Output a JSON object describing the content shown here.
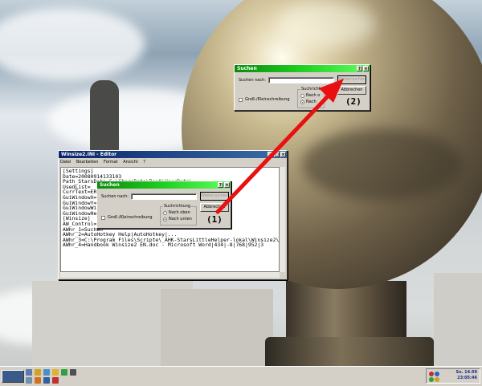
{
  "editor": {
    "title": "Winsize2.INI - Editor",
    "menu": [
      "Datei",
      "Bearbeiten",
      "Format",
      "Ansicht",
      "?"
    ],
    "lines": [
      "[Settings]",
      "Date=20080914133103",
      "Path_StarsData=C:\\StarsData\\Root\\UserData\\",
      "UsedList=",
      "CurrText=ERRO",
      "GuiWindowX=ERR",
      "GuiWindowY=ERR",
      "GuiWindowWidt",
      "GuiWindowHeig",
      "[Winsize]",
      "AW_Control=AT",
      "AWhr_1=Suchen",
      "AWhr_2=AutoHotkey Help|AutoHotkey|...",
      "AWhr_3=C:\\Program Files\\Scripte\\_AHK-StarsLittleHelper-lokal\\Winsize2\\Wir",
      "AWhr_4=Handbook Winsize2 EN.doc - Microsoft Word|434|-8|768|952|3"
    ]
  },
  "dialog1": {
    "title": "Suchen",
    "search_label": "Suchen nach:",
    "search_value": "",
    "find_next": "Weitersuchen",
    "cancel": "Abbrechen",
    "direction_caption": "Suchrichtung",
    "option_up": "Nach oben",
    "option_down": "Nach unten",
    "case_label": "Groß-/Kleinschreibung",
    "annotation": "(1)"
  },
  "dialog2": {
    "title": "Suchen",
    "search_label": "Suchen nach:",
    "search_value": "",
    "find_next": "Weitersuchen",
    "cancel": "Abbrechen",
    "direction_caption": "Suchrichtung",
    "option_up": "Nach o",
    "option_down": "Nach",
    "case_label": "Groß-/Kleinschreibung",
    "annotation": "(2)"
  },
  "taskbar": {
    "day": "So. 14.09",
    "time": "23:05:46"
  },
  "colors": {
    "arrow": "#e81010",
    "title_green": "#20d020"
  }
}
